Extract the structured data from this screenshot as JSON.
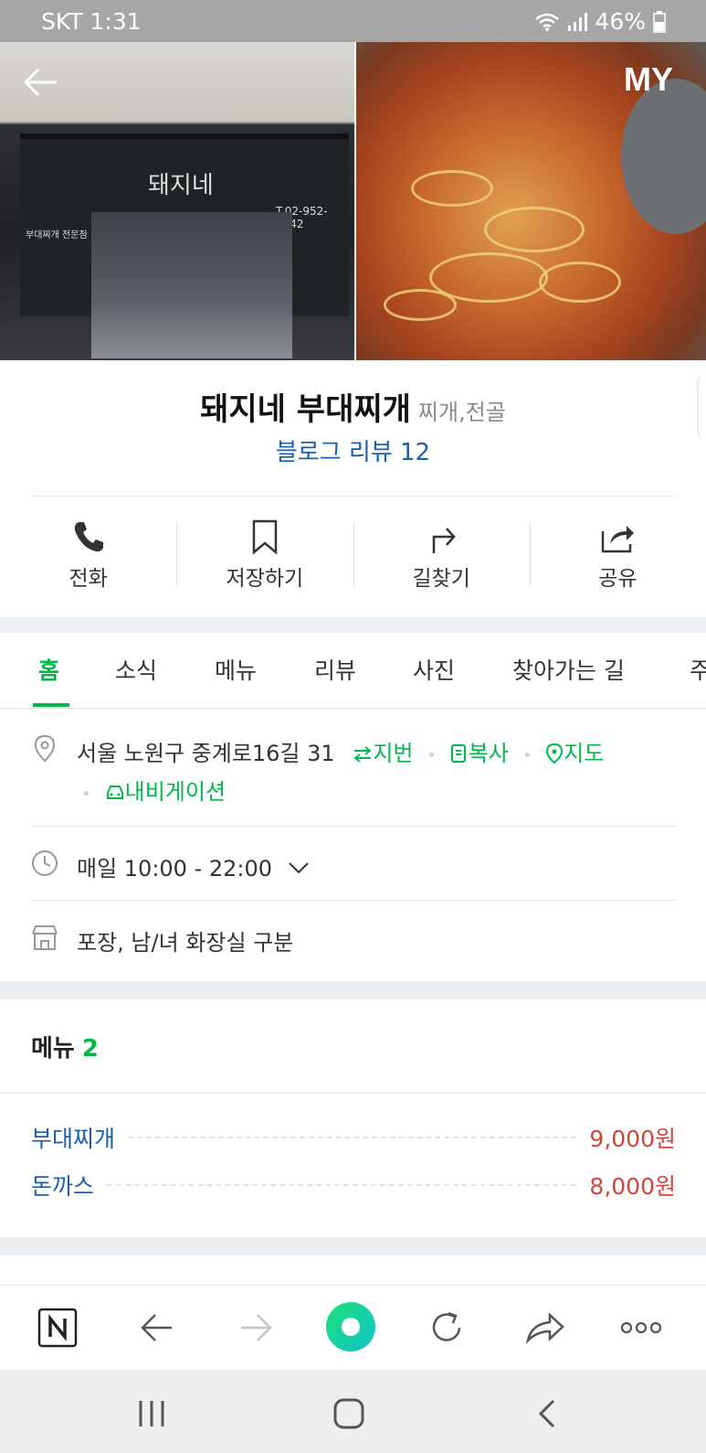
{
  "status_bar": {
    "carrier_time": "SKT 1:31",
    "battery": "46%"
  },
  "hero": {
    "my_label": "MY",
    "store_phone_sign": "T.02-952-5042",
    "store_sign_tag": "부대찌개 전문점",
    "store_logo": "돼지네"
  },
  "place": {
    "name": "돼지네 부대찌개",
    "category": "찌개,전골",
    "blog_review": "블로그 리뷰 12"
  },
  "actions": [
    {
      "label": "전화",
      "icon": "phone-icon"
    },
    {
      "label": "저장하기",
      "icon": "bookmark-icon"
    },
    {
      "label": "길찾기",
      "icon": "directions-icon"
    },
    {
      "label": "공유",
      "icon": "share-icon"
    }
  ],
  "tabs": [
    "홈",
    "소식",
    "메뉴",
    "리뷰",
    "사진",
    "찾아가는 길",
    "주"
  ],
  "info": {
    "address": "서울 노원구 중계로16길 31",
    "address_links": [
      "지번",
      "복사",
      "지도",
      "내비게이션"
    ],
    "hours": "매일 10:00 - 22:00",
    "amenities": "포장, 남/녀 화장실 구분"
  },
  "menu": {
    "title": "메뉴",
    "count": "2",
    "items": [
      {
        "name": "부대찌개",
        "price": "9,000원"
      },
      {
        "name": "돈까스",
        "price": "8,000원"
      }
    ]
  },
  "colors": {
    "accent_green": "#03b74b",
    "link_blue": "#1a5fa8",
    "price_red": "#d2443a"
  }
}
